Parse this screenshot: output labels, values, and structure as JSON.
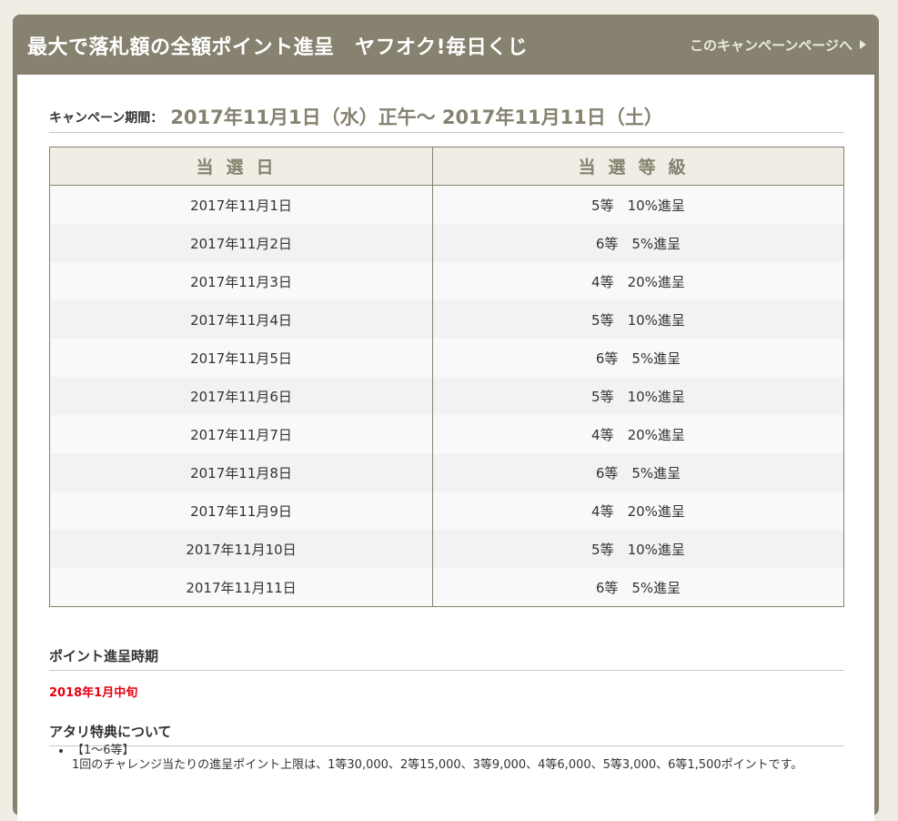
{
  "header": {
    "title": "最大で落札額の全額ポイント進呈　ヤフオク!毎日くじ",
    "campaign_link": "このキャンペーンページへ"
  },
  "period": {
    "label": "キャンペーン期間：",
    "value": "2017年11月1日（水）正午～ 2017年11月11日（土）"
  },
  "table": {
    "headers": [
      "当選日",
      "当選等級"
    ],
    "rows": [
      {
        "date": "2017年11月1日",
        "grade": "5等　10%進呈"
      },
      {
        "date": "2017年11月2日",
        "grade": "6等　5%進呈"
      },
      {
        "date": "2017年11月3日",
        "grade": "4等　20%進呈"
      },
      {
        "date": "2017年11月4日",
        "grade": "5等　10%進呈"
      },
      {
        "date": "2017年11月5日",
        "grade": "6等　5%進呈"
      },
      {
        "date": "2017年11月6日",
        "grade": "5等　10%進呈"
      },
      {
        "date": "2017年11月7日",
        "grade": "4等　20%進呈"
      },
      {
        "date": "2017年11月8日",
        "grade": "6等　5%進呈"
      },
      {
        "date": "2017年11月9日",
        "grade": "4等　20%進呈"
      },
      {
        "date": "2017年11月10日",
        "grade": "5等　10%進呈"
      },
      {
        "date": "2017年11月11日",
        "grade": "6等　5%進呈"
      }
    ]
  },
  "point_timing": {
    "heading": "ポイント進呈時期",
    "value": "2018年1月中旬"
  },
  "benefits": {
    "heading": "アタリ特典について",
    "items": [
      {
        "title": "【1～6等】",
        "text": "1回のチャレンジ当たりの進呈ポイント上限は、1等30,000、2等15,000、3等9,000、4等6,000、5等3,000、6等1,500ポイントです。"
      }
    ]
  },
  "colors": {
    "frame": "#86826f",
    "background": "#efede4",
    "accent_red": "#e60012"
  }
}
